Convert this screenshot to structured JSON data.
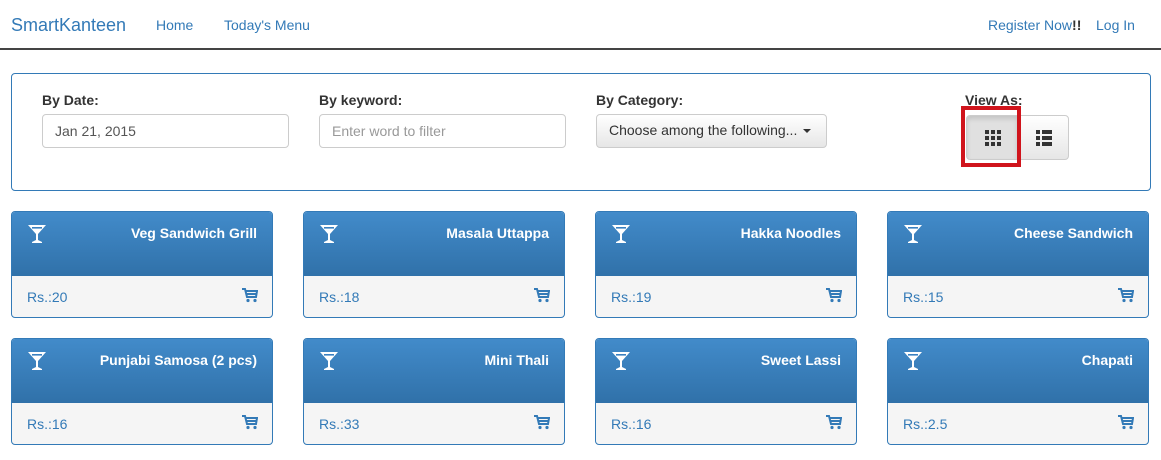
{
  "navbar": {
    "brand": "SmartKanteen",
    "links": [
      "Home",
      "Today's Menu"
    ],
    "register_label": "Register Now",
    "register_suffix": "!!",
    "login_label": "Log In"
  },
  "filters": {
    "date_label": "By Date:",
    "date_value": "Jan 21, 2015",
    "keyword_label": "By keyword:",
    "keyword_placeholder": "Enter word to filter",
    "category_label": "By Category:",
    "category_selected": "Choose among the following...",
    "view_label": "View As:",
    "view_modes": [
      "grid-view-icon",
      "list-view-icon"
    ],
    "active_view": "grid"
  },
  "menu_items": [
    {
      "name": "Veg Sandwich Grill",
      "price": "Rs.:20"
    },
    {
      "name": "Masala Uttappa",
      "price": "Rs.:18"
    },
    {
      "name": "Hakka Noodles",
      "price": "Rs.:19"
    },
    {
      "name": "Cheese Sandwich",
      "price": "Rs.:15"
    },
    {
      "name": "Punjabi Samosa (2 pcs)",
      "price": "Rs.:16"
    },
    {
      "name": "Mini Thali",
      "price": "Rs.:33"
    },
    {
      "name": "Sweet Lassi",
      "price": "Rs.:16"
    },
    {
      "name": "Chapati",
      "price": "Rs.:2.5"
    }
  ],
  "colors": {
    "primary": "#337ab7",
    "card_header": "#3a80c0",
    "highlight": "#d0141c"
  }
}
